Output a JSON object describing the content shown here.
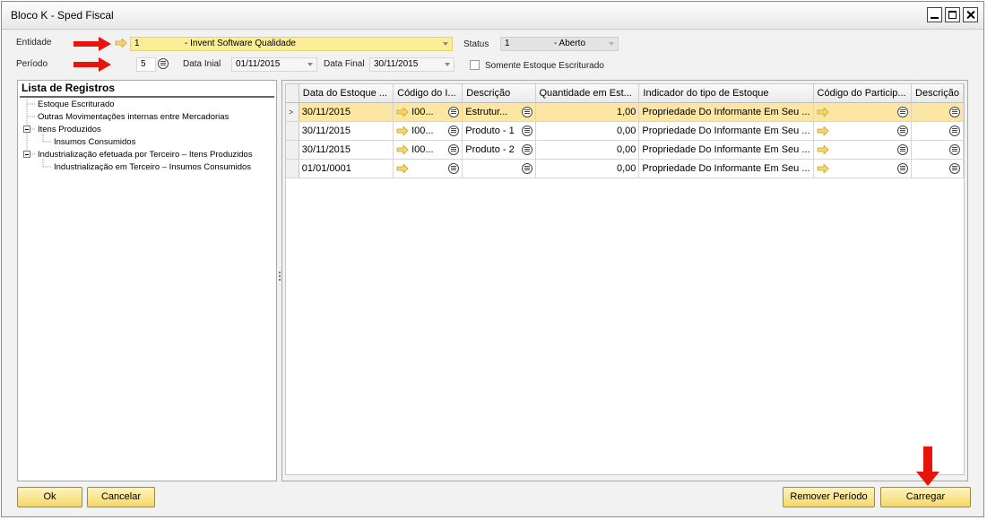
{
  "window": {
    "title": "Bloco K - Sped Fiscal"
  },
  "header": {
    "entidade_label": "Entidade",
    "entidade_code": "1",
    "entidade_value": "- Invent Software Qualidade",
    "status_label": "Status",
    "status_code": "1",
    "status_value": "- Aberto",
    "periodo_label": "Período",
    "periodo_value": "5",
    "data_inicial_label": "Data Inial",
    "data_inicial_value": "01/11/2015",
    "data_final_label": "Data Final",
    "data_final_value": "30/11/2015",
    "somente_label": "Somente Estoque Escriturado"
  },
  "registros": {
    "title": "Lista de Registros",
    "items": [
      {
        "label": "Estoque Escriturado"
      },
      {
        "label": "Outras Movimentações internas entre Mercadorias"
      },
      {
        "label": "Itens Produzidos"
      },
      {
        "label": "Insumos Consumidos"
      },
      {
        "label": "Industrialização efetuada por Terceiro – Itens Produzidos"
      },
      {
        "label": "Industrialização em Terceiro – Insumos Consumidos"
      }
    ]
  },
  "grid": {
    "columns": [
      "Data do Estoque ...",
      "Código do I...",
      "Descrição",
      "Quantidade em Est...",
      "Indicador do tipo de Estoque",
      "Código do Particip...",
      "Descrição"
    ],
    "rows": [
      {
        "data": "30/11/2015",
        "codigo": "I00...",
        "descricao": "Estrutur...",
        "quantidade": "1,00",
        "indicador": "Propriedade Do Informante Em Seu ...",
        "participante": "",
        "descricao2": "",
        "selected": true
      },
      {
        "data": "30/11/2015",
        "codigo": "I00...",
        "descricao": "Produto - 1",
        "quantidade": "0,00",
        "indicador": "Propriedade Do Informante Em Seu ...",
        "participante": "",
        "descricao2": "",
        "selected": false
      },
      {
        "data": "30/11/2015",
        "codigo": "I00...",
        "descricao": "Produto - 2",
        "quantidade": "0,00",
        "indicador": "Propriedade Do Informante Em Seu ...",
        "participante": "",
        "descricao2": "",
        "selected": false
      },
      {
        "data": "01/01/0001",
        "codigo": "",
        "descricao": "",
        "quantidade": "0,00",
        "indicador": "Propriedade Do Informante Em Seu ...",
        "participante": "",
        "descricao2": "",
        "selected": false
      }
    ]
  },
  "buttons": {
    "ok": "Ok",
    "cancelar": "Cancelar",
    "remover": "Remover Período",
    "carregar": "Carregar"
  },
  "colors": {
    "highlight_yellow": "#fbee96",
    "selected_row": "#fbe6a4",
    "annotation_red": "#e8140c",
    "button_gold": "#f5d86a"
  }
}
